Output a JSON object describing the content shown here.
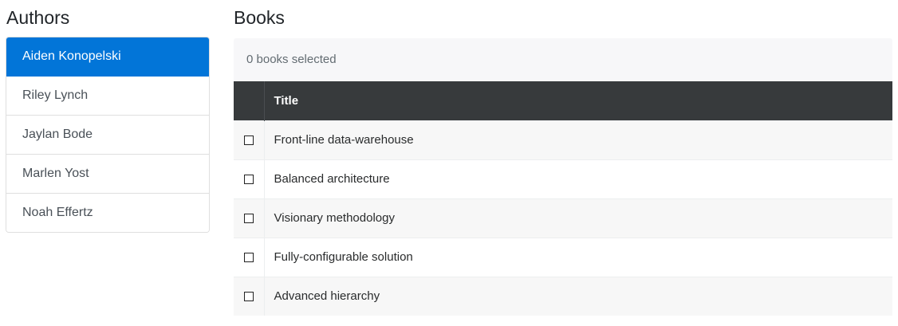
{
  "authors": {
    "heading": "Authors",
    "items": [
      {
        "name": "Aiden Konopelski",
        "active": true
      },
      {
        "name": "Riley Lynch",
        "active": false
      },
      {
        "name": "Jaylan Bode",
        "active": false
      },
      {
        "name": "Marlen Yost",
        "active": false
      },
      {
        "name": "Noah Effertz",
        "active": false
      }
    ]
  },
  "books": {
    "heading": "Books",
    "selection_status": "0 books selected",
    "columns": {
      "title": "Title"
    },
    "rows": [
      {
        "title": "Front-line data-warehouse",
        "checked": false
      },
      {
        "title": "Balanced architecture",
        "checked": false
      },
      {
        "title": "Visionary methodology",
        "checked": false
      },
      {
        "title": "Fully-configurable solution",
        "checked": false
      },
      {
        "title": "Advanced hierarchy",
        "checked": false
      }
    ]
  },
  "colors": {
    "active_author_bg": "#0275d8",
    "table_header_bg": "#373a3c"
  }
}
